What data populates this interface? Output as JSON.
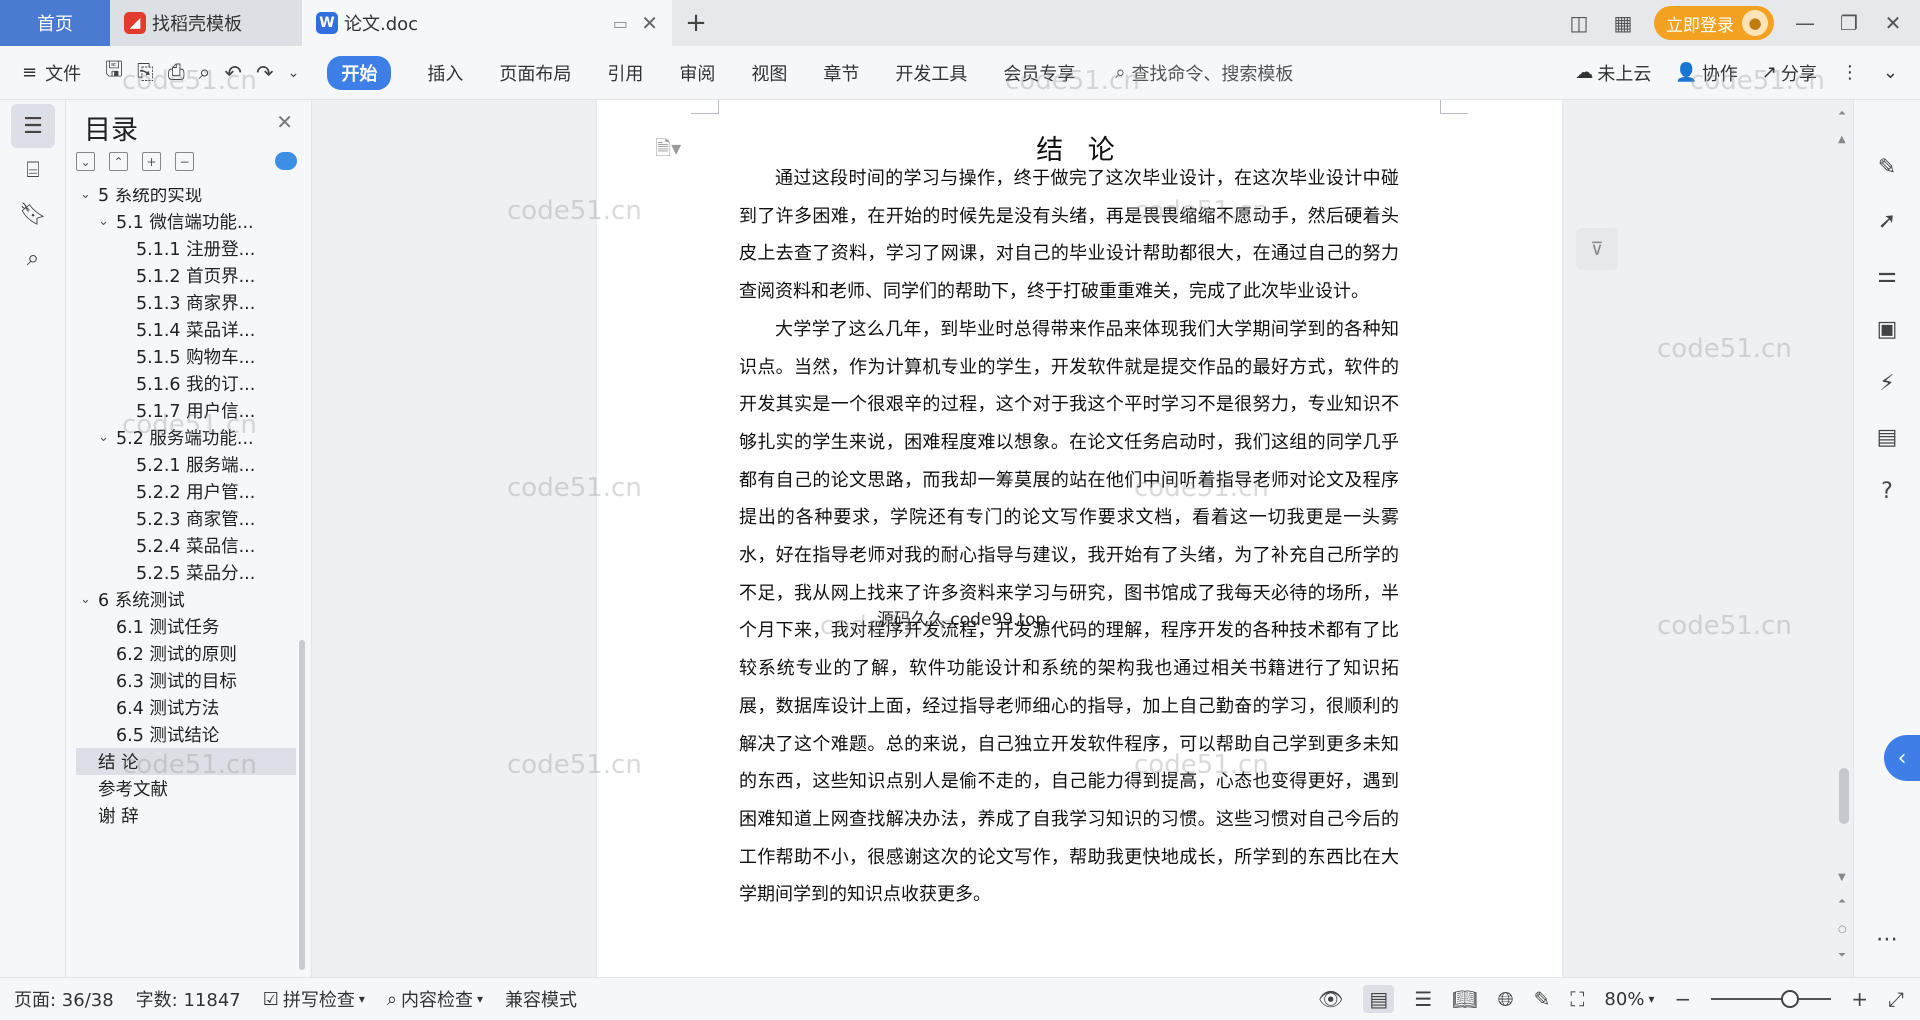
{
  "tabs": {
    "home": "首页",
    "template_tab": "找稻壳模板",
    "doc_tab": "论文.doc",
    "add": "+"
  },
  "window": {
    "login": "立即登录"
  },
  "toolbar": {
    "file": "文件",
    "tabs": [
      "开始",
      "插入",
      "页面布局",
      "引用",
      "审阅",
      "视图",
      "章节",
      "开发工具",
      "会员专享"
    ],
    "search": "查找命令、搜索模板",
    "cloud": "未上云",
    "collab": "协作",
    "share": "分享"
  },
  "toc": {
    "title": "目录",
    "items": [
      {
        "label": "5 系统的实现",
        "level": 0,
        "arrow": "v"
      },
      {
        "label": "5.1 微信端功能...",
        "level": 1,
        "arrow": "v"
      },
      {
        "label": "5.1.1 注册登...",
        "level": 2,
        "arrow": ""
      },
      {
        "label": "5.1.2 首页界...",
        "level": 2,
        "arrow": ""
      },
      {
        "label": "5.1.3 商家界...",
        "level": 2,
        "arrow": ""
      },
      {
        "label": "5.1.4 菜品详...",
        "level": 2,
        "arrow": ""
      },
      {
        "label": "5.1.5 购物车...",
        "level": 2,
        "arrow": ""
      },
      {
        "label": "5.1.6 我的订...",
        "level": 2,
        "arrow": ""
      },
      {
        "label": "5.1.7 用户信...",
        "level": 2,
        "arrow": ""
      },
      {
        "label": "5.2 服务端功能...",
        "level": 1,
        "arrow": "v"
      },
      {
        "label": "5.2.1 服务端...",
        "level": 2,
        "arrow": ""
      },
      {
        "label": "5.2.2 用户管...",
        "level": 2,
        "arrow": ""
      },
      {
        "label": "5.2.3 商家管...",
        "level": 2,
        "arrow": ""
      },
      {
        "label": "5.2.4 菜品信...",
        "level": 2,
        "arrow": ""
      },
      {
        "label": "5.2.5 菜品分...",
        "level": 2,
        "arrow": ""
      },
      {
        "label": "6 系统测试",
        "level": 0,
        "arrow": "v"
      },
      {
        "label": "6.1 测试任务",
        "level": 1,
        "arrow": ""
      },
      {
        "label": "6.2 测试的原则",
        "level": 1,
        "arrow": ""
      },
      {
        "label": "6.3 测试的目标",
        "level": 1,
        "arrow": ""
      },
      {
        "label": "6.4 测试方法",
        "level": 1,
        "arrow": ""
      },
      {
        "label": "6.5 测试结论",
        "level": 1,
        "arrow": ""
      },
      {
        "label": "结 论",
        "level": 0,
        "arrow": "",
        "selected": true
      },
      {
        "label": "参考文献",
        "level": 0,
        "arrow": ""
      },
      {
        "label": "谢 辞",
        "level": 0,
        "arrow": ""
      }
    ]
  },
  "document": {
    "title": "结 论",
    "paragraphs": [
      "通过这段时间的学习与操作，终于做完了这次毕业设计，在这次毕业设计中碰到了许多困难，在开始的时候先是没有头绪，再是畏畏缩缩不愿动手，然后硬着头皮上去查了资料，学习了网课，对自己的毕业设计帮助都很大，在通过自己的努力查阅资料和老师、同学们的帮助下，终于打破重重难关，完成了此次毕业设计。",
      "大学学了这么几年，到毕业时总得带来作品来体现我们大学期间学到的各种知识点。当然，作为计算机专业的学生，开发软件就是提交作品的最好方式，软件的开发其实是一个很艰辛的过程，这个对于我这个平时学习不是很努力，专业知识不够扎实的学生来说，困难程度难以想象。在论文任务启动时，我们这组的同学几乎都有自己的论文思路，而我却一筹莫展的站在他们中间听着指导老师对论文及程序提出的各种要求，学院还有专门的论文写作要求文档，看着这一切我更是一头雾水，好在指导老师对我的耐心指导与建议，我开始有了头绪，为了补充自己所学的不足，我从网上找来了许多资料来学习与研究，图书馆成了我每天必待的场所，半个月下来，我对程序开发流程，开发源代码的理解，程序开发的各种技术都有了比较系统专业的了解，软件功能设计和系统的架构我也通过相关书籍进行了知识拓展，数据库设计上面，经过指导老师细心的指导，加上自己勤奋的学习，很顺利的解决了这个难题。总的来说，自己独立开发软件程序，可以帮助自己学到更多未知的东西，这些知识点别人是偷不走的，自己能力得到提高，心态也变得更好，遇到困难知道上网查找解决办法，养成了自我学习知识的习惯。这些习惯对自己今后的工作帮助不小，很感谢这次的论文写作，帮助我更快地成长，所学到的东西比在大学期间学到的知识点收获更多。"
    ],
    "overlay": "源码久久 code99.top",
    "watermark": "code51.cn"
  },
  "status": {
    "page": "页面: 36/38",
    "words": "字数: 11847",
    "spell": "拼写检查",
    "content": "内容检查",
    "compat": "兼容模式",
    "zoom": "80%"
  }
}
